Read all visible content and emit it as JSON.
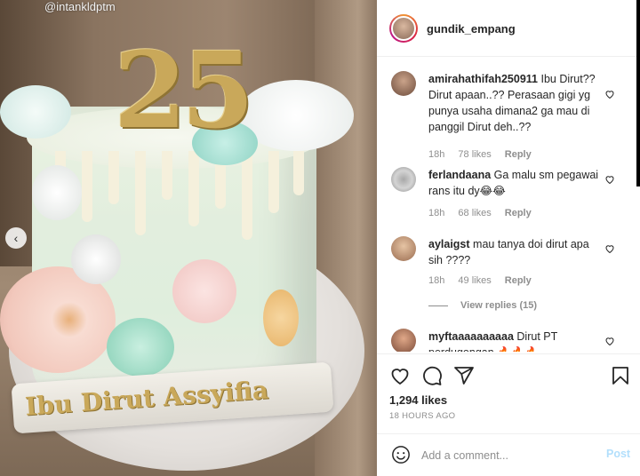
{
  "photo": {
    "watermark": "@intankldptm",
    "cake_number": "25",
    "cake_ribbon_text": "Ibu Dirut Assyifia"
  },
  "post": {
    "username": "gundik_empang",
    "likes": "1,294 likes",
    "time": "18 HOURS AGO"
  },
  "comments": [
    {
      "user": "amirahathifah250911",
      "text": "Ibu Dirut?? Dirut apaan..?? Perasaan gigi yg punya usaha dimana2 ga mau di panggil Dirut deh..??",
      "age": "18h",
      "likes": "78 likes",
      "reply": "Reply"
    },
    {
      "user": "ferlandaana",
      "text": "Ga malu sm pegawai rans itu dy😂😂",
      "age": "18h",
      "likes": "68 likes",
      "reply": "Reply"
    },
    {
      "user": "aylaigst",
      "text": "mau tanya doi dirut apa sih ????",
      "age": "18h",
      "likes": "49 likes",
      "reply": "Reply",
      "view_replies": "View replies (15)"
    },
    {
      "user": "myftaaaaaaaaaa",
      "text": "Dirut PT perdugongan 🔥🔥🔥",
      "age": "",
      "likes": "",
      "reply": ""
    }
  ],
  "add_comment": {
    "placeholder": "Add a comment...",
    "post_label": "Post"
  },
  "icons": {
    "like": "heart-icon",
    "comment": "comment-icon",
    "share": "share-icon",
    "save": "bookmark-icon",
    "emoji": "emoji-icon",
    "nav_prev": "chevron-left-icon"
  },
  "colors": {
    "text": "#262626",
    "meta": "#8e8e8e",
    "post_disabled": "#b2dffc",
    "divider": "#efefef"
  }
}
